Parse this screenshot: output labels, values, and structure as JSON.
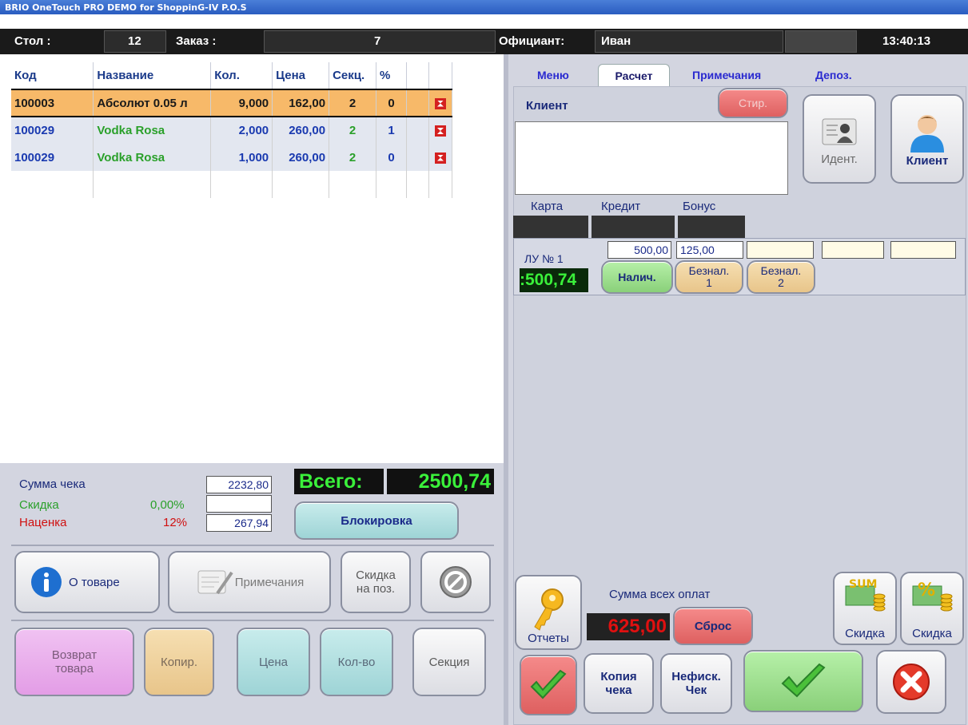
{
  "window": {
    "title": "BRIO OneTouch PRO DEMO for ShoppinG-IV P.O.S"
  },
  "header": {
    "table_label": "Стол :",
    "table_value": "12",
    "order_label": "Заказ :",
    "order_value": "7",
    "waiter_label": "Официант:",
    "waiter_value": "Иван",
    "time": "13:40:13"
  },
  "order_table": {
    "columns": [
      "Код",
      "Название",
      "Кол.",
      "Цена",
      "Секц.",
      "%"
    ],
    "rows": [
      {
        "code": "100003",
        "name": "Абсолют 0.05 л",
        "qty": "9,000",
        "price": "162,00",
        "section": "2",
        "pct": "0"
      },
      {
        "code": "100029",
        "name": "Vodka Rosa",
        "qty": "2,000",
        "price": "260,00",
        "section": "2",
        "pct": "1"
      },
      {
        "code": "100029",
        "name": "Vodka Rosa",
        "qty": "1,000",
        "price": "260,00",
        "section": "2",
        "pct": "0"
      }
    ]
  },
  "summary": {
    "sum_label": "Сумма чека",
    "sum_value": "2232,80",
    "discount_label": "Скидка",
    "discount_pct": "0,00%",
    "markup_label": "Наценка",
    "markup_pct": "12%",
    "markup_value": "267,94",
    "total_label": "Всего:",
    "total_value": "2500,74",
    "lock_button": "Блокировка"
  },
  "left_buttons": {
    "about_item": "О товаре",
    "notes": "Примечания",
    "discount_line1": "Скидка",
    "discount_line2": "на поз.",
    "return_line1": "Возврат",
    "return_line2": "товара",
    "copy": "Копир.",
    "price": "Цена",
    "qty": "Кол-во",
    "section": "Секция"
  },
  "tabs": {
    "menu": "Меню",
    "payment": "Расчет",
    "notes": "Примечания",
    "deposit": "Депоз."
  },
  "payment": {
    "client_label": "Клиент",
    "erase_button": "Стир.",
    "ident_button": "Идент.",
    "client_button": "Клиент",
    "card_label": "Карта",
    "credit_label": "Кредит",
    "bonus_label": "Бонус",
    "lu_label": "ЛУ № 1",
    "lu_amount": ":500,74",
    "cash_amount": "500,00",
    "cashless1_amount": "125,00",
    "cash_button": "Налич.",
    "cashless1_line1": "Безнал.",
    "cashless1_line2": "1",
    "cashless2_line1": "Безнал.",
    "cashless2_line2": "2",
    "all_payments_label": "Сумма всех оплат",
    "all_payments_value": "625,00",
    "reset_button": "Сброс",
    "reports_button": "Отчеты",
    "discount_sum_button": "Скидка",
    "discount_pct_button": "Скидка",
    "receipt_copy_line1": "Копия",
    "receipt_copy_line2": "чека",
    "nonfiscal_line1": "Нефиск.",
    "nonfiscal_line2": "Чек"
  },
  "colors": {
    "accent_green": "#2ecc40",
    "header_dark": "#1a1a1a",
    "selected_row": "#f7b969"
  }
}
